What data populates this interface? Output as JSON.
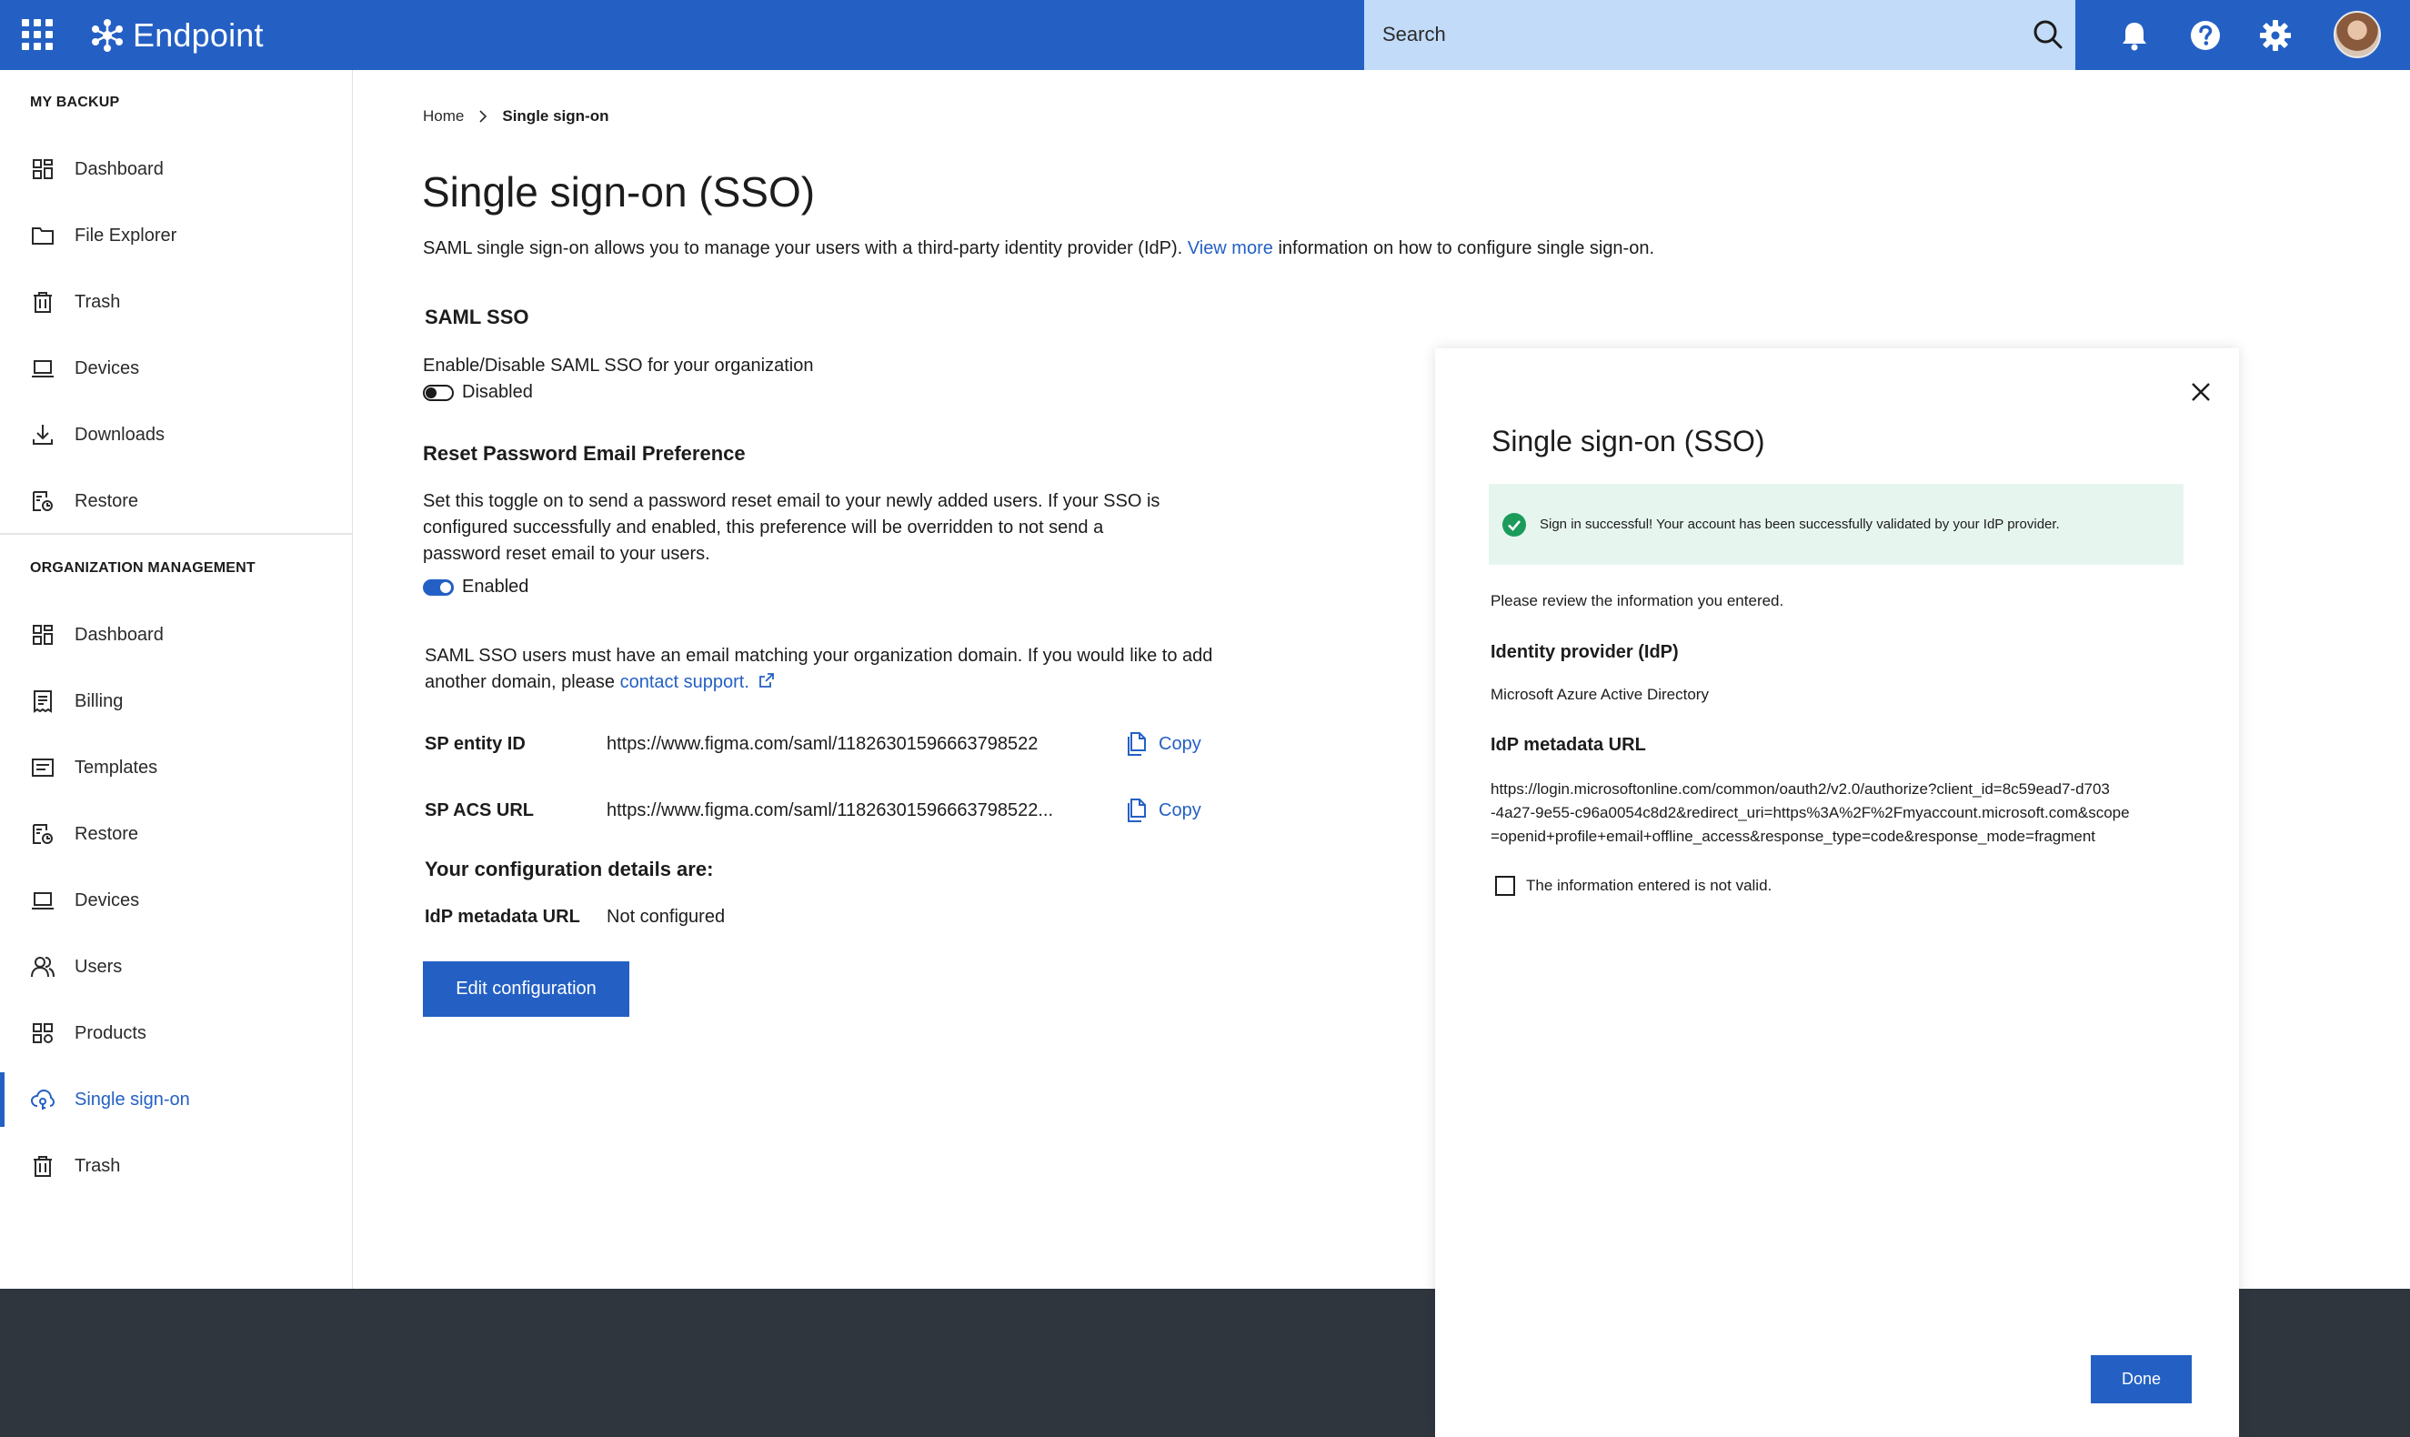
{
  "app": {
    "brand": "Endpoint"
  },
  "search": {
    "placeholder": "Search"
  },
  "sidebar": {
    "my_backup_title": "MY BACKUP",
    "my_backup_items": [
      {
        "label": "Dashboard",
        "icon": "dashboard-icon"
      },
      {
        "label": "File Explorer",
        "icon": "folder-icon"
      },
      {
        "label": "Trash",
        "icon": "trash-icon"
      },
      {
        "label": "Devices",
        "icon": "laptop-icon"
      },
      {
        "label": "Downloads",
        "icon": "download-icon"
      },
      {
        "label": "Restore",
        "icon": "restore-icon"
      }
    ],
    "org_title": "ORGANIZATION MANAGEMENT",
    "org_items": [
      {
        "label": "Dashboard",
        "icon": "dashboard-icon"
      },
      {
        "label": "Billing",
        "icon": "billing-icon"
      },
      {
        "label": "Templates",
        "icon": "templates-icon"
      },
      {
        "label": "Restore",
        "icon": "restore-icon"
      },
      {
        "label": "Devices",
        "icon": "laptop-icon"
      },
      {
        "label": "Users",
        "icon": "users-icon"
      },
      {
        "label": "Products",
        "icon": "products-icon"
      },
      {
        "label": "Single sign-on",
        "icon": "cloud-key-icon",
        "active": true
      },
      {
        "label": "Trash",
        "icon": "trash-icon"
      }
    ]
  },
  "breadcrumb": {
    "home": "Home",
    "current": "Single sign-on"
  },
  "main": {
    "title": "Single sign-on (SSO)",
    "desc_before": "SAML single sign-on allows you to manage your users with a third-party identity provider (IdP). ",
    "desc_link": "View more",
    "desc_after": " information on how to configure single sign-on.",
    "saml_heading": "SAML SSO",
    "saml_toggle_desc": "Enable/Disable SAML SSO for your organization",
    "saml_toggle_state": "Disabled",
    "reset_heading": "Reset Password Email Preference",
    "reset_desc_1": "Set this toggle on to send a password reset email to your newly added users. If your SSO is",
    "reset_desc_2": "configured successfully and enabled, this preference will be overridden to not send a",
    "reset_desc_3": "password reset email to your users.",
    "reset_toggle_state": "Enabled",
    "domain_note_1": "SAML SSO users must have an email matching your organization domain. If you would like to add",
    "domain_note_2": "another domain, please ",
    "domain_link": "contact support.",
    "sp_entity_label": "SP entity ID",
    "sp_entity_value": "https://www.figma.com/saml/1182630159666379852​2",
    "sp_acs_label": "SP ACS URL",
    "sp_acs_value": "https://www.figma.com/saml/11826301596663798522...",
    "copy_label": "Copy",
    "config_heading": "Your configuration details are:",
    "idp_label": "IdP metadata URL",
    "idp_value": "Not configured",
    "edit_button": "Edit configuration"
  },
  "panel": {
    "title": "Single sign-on (SSO)",
    "alert": "Sign in successful! Your account has been successfully validated by your IdP provider.",
    "review_text": "Please review the information you entered.",
    "idp_heading": "Identity provider (IdP)",
    "idp_value": "Microsoft Azure Active Directory",
    "url_heading": "IdP metadata URL",
    "url_line_1": "https://login.microsoftonline.com/common/oauth2/v2.0/authorize?client_id=8c59ead7-d703",
    "url_line_2": "-4a27-9e55-c96a0054c8d2&redirect_uri=https%3A%2F%2Fmyaccount.microsoft.com&scope",
    "url_line_3": "=openid+profile+email+offline_access&response_type=code&response_mode=fragment",
    "checkbox_label": "The information entered is not valid.",
    "done_button": "Done"
  },
  "colors": {
    "brand": "#2460c4",
    "search_bg": "#c1dbf8",
    "alert_bg": "#e7f5ef",
    "success": "#1a9b5a",
    "footer": "#30363e"
  }
}
